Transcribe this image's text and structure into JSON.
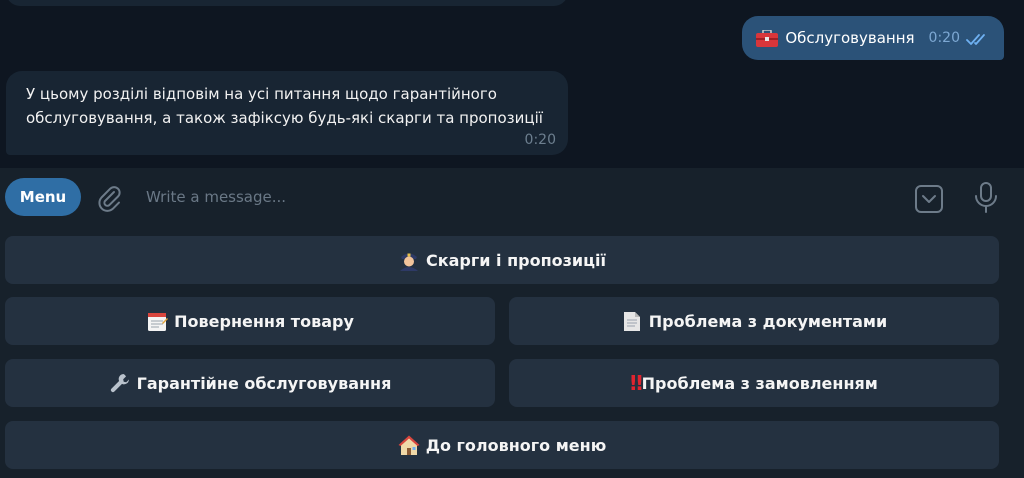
{
  "chat": {
    "outgoing": {
      "icon": "toolbox-icon",
      "text": "Обслуговування",
      "time": "0:20",
      "status": "read-double-check-icon"
    },
    "incoming": {
      "text": "У цьому розділі відповім на усі питання щодо гарантійного\nобслуговування, а також зафіксую будь-які скарги та пропозиції",
      "time": "0:20"
    }
  },
  "input_bar": {
    "menu_label": "Menu",
    "placeholder": "Write a message..."
  },
  "keyboard": {
    "complaints": {
      "icon": "police-officer-icon",
      "label": "Скарги і пропозиції"
    },
    "return_goods": {
      "icon": "notepad-icon",
      "label": "Повернення товару"
    },
    "documents": {
      "icon": "page-facing-up-icon",
      "label": "Проблема з документами"
    },
    "warranty": {
      "icon": "wrench-icon",
      "label": "Гарантійне обслуговування"
    },
    "order_problem": {
      "icon": "double-exclamation-icon",
      "label": "‼",
      "text": "Проблема з замовленням"
    },
    "main_menu": {
      "icon": "house-icon",
      "label": "До головного меню"
    }
  },
  "colors": {
    "background": "#0e1621",
    "panel": "#17212b",
    "incoming_bubble": "#182533",
    "outgoing_bubble": "#2b5278",
    "menu_button": "#2f6ea5",
    "keyboard_button": "#243140"
  }
}
